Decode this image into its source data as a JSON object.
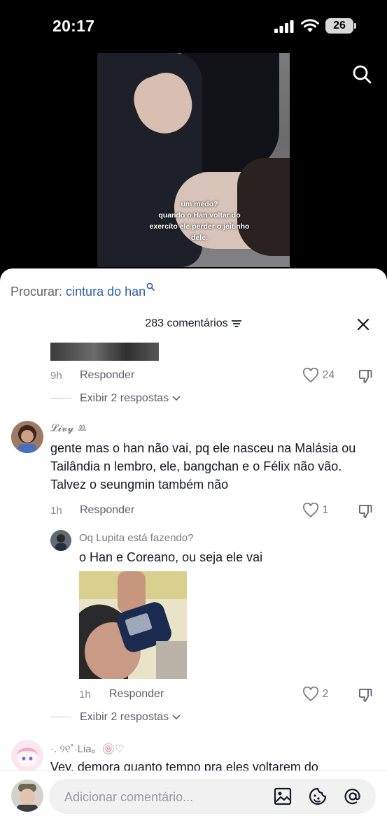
{
  "status_bar": {
    "time": "20:17",
    "battery": "26"
  },
  "video": {
    "caption_lines": [
      "um medo?",
      "quando o Han voltar do",
      "exercíto ele perder o jeitinho",
      "dele."
    ]
  },
  "sheet": {
    "search_label": "Procurar:",
    "search_term": "cintura do han",
    "comment_count": "283 comentários"
  },
  "comments": [
    {
      "time": "9h",
      "reply_label": "Responder",
      "likes": "24",
      "view_replies": "Exibir 2 respostas"
    },
    {
      "username": "𝓛𝓲𝓿𝔂 ꔛ",
      "text": "gente mas o han não vai, pq ele nasceu na Malásia ou Tailândia n lembro, ele, bangchan e o Félix não vão. Talvez o seungmin também não",
      "time": "1h",
      "reply_label": "Responder",
      "likes": "1",
      "reply": {
        "username": "Oq Lupita está fazendo?",
        "text": "o Han e Coreano, ou seja ele vai",
        "time": "1h",
        "reply_label": "Responder",
        "likes": "2"
      },
      "view_replies": "Exibir 2 respostas"
    },
    {
      "username": "·. ୨୧˚·Lia。🍥♡",
      "text": "Vey, demora quanto tempo pra eles voltarem do"
    }
  ],
  "bottom_bar": {
    "placeholder": "Adicionar comentário..."
  }
}
